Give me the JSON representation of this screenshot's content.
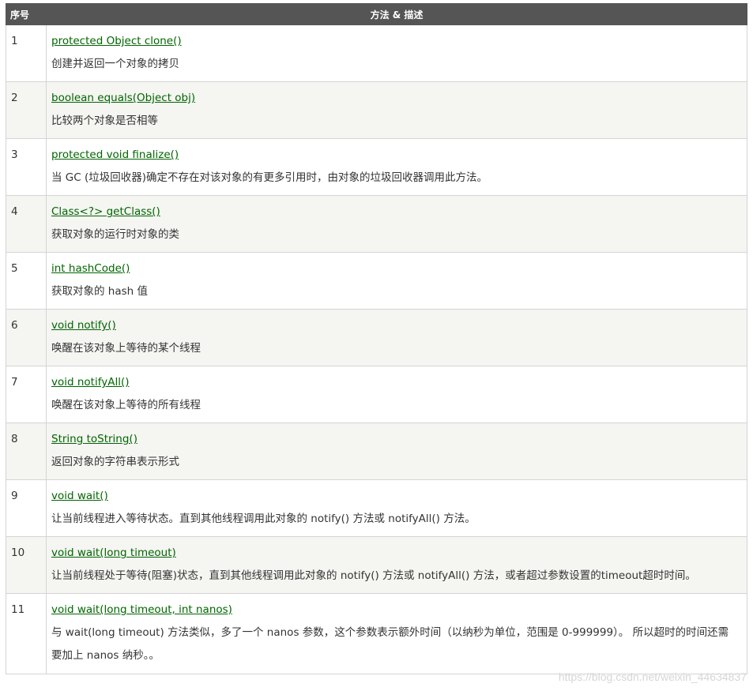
{
  "header": {
    "col_number": "序号",
    "col_method": "方法 & 描述"
  },
  "rows": [
    {
      "number": "1",
      "signature": "protected Object clone()",
      "description": "创建并返回一个对象的拷贝"
    },
    {
      "number": "2",
      "signature": "boolean equals(Object obj)",
      "description": "比较两个对象是否相等"
    },
    {
      "number": "3",
      "signature": "protected void finalize()",
      "description": "当 GC (垃圾回收器)确定不存在对该对象的有更多引用时，由对象的垃圾回收器调用此方法。"
    },
    {
      "number": "4",
      "signature": "Class<?> getClass()",
      "description": "获取对象的运行时对象的类"
    },
    {
      "number": "5",
      "signature": "int hashCode()",
      "description": "获取对象的 hash 值"
    },
    {
      "number": "6",
      "signature": "void notify()",
      "description": "唤醒在该对象上等待的某个线程"
    },
    {
      "number": "7",
      "signature": "void notifyAll()",
      "description": "唤醒在该对象上等待的所有线程"
    },
    {
      "number": "8",
      "signature": "String toString()",
      "description": "返回对象的字符串表示形式"
    },
    {
      "number": "9",
      "signature": "void wait()",
      "description": "让当前线程进入等待状态。直到其他线程调用此对象的 notify() 方法或 notifyAll() 方法。"
    },
    {
      "number": "10",
      "signature": "void wait(long timeout)",
      "description": "让当前线程处于等待(阻塞)状态，直到其他线程调用此对象的 notify() 方法或 notifyAll() 方法，或者超过参数设置的timeout超时时间。"
    },
    {
      "number": "11",
      "signature": "void wait(long timeout, int nanos)",
      "description": "与 wait(long timeout) 方法类似，多了一个 nanos 参数，这个参数表示额外时间（以纳秒为单位，范围是 0-999999）。 所以超时的时间还需要加上 nanos 纳秒。。"
    }
  ],
  "watermark": "https://blog.csdn.net/weixin_44634837",
  "colors": {
    "header_bg": "#555555",
    "link": "#006600",
    "alt_row_bg": "#f5f5f2",
    "border": "#d4d4d4"
  }
}
